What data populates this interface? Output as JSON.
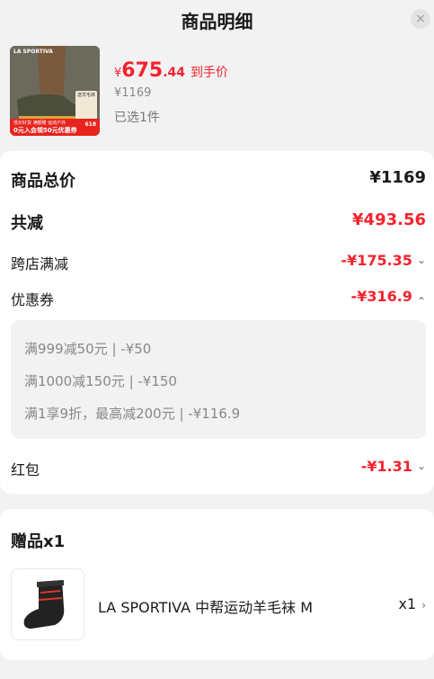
{
  "header": {
    "title": "商品明细",
    "close_label": "×"
  },
  "product": {
    "image_brand": "LA SPORTIVA",
    "image_badge": "送羊毛袜",
    "image_strip_top": "低价好货 满额赠 运动户外",
    "image_strip_main": "0元入会领50元优惠券",
    "image_strip_right": "618",
    "price_currency": "¥",
    "price_int": "675",
    "price_dec": ".44",
    "price_label": "到手价",
    "original_price": "¥1169",
    "selected": "已选1件"
  },
  "summary": {
    "total_label": "商品总价",
    "total_value": "¥1169",
    "discount_label": "共减",
    "discount_value": "¥493.56",
    "cross_store_label": "跨店满减",
    "cross_store_value": "-¥175.35",
    "coupon_label": "优惠券",
    "coupon_value": "-¥316.9",
    "coupon_details": [
      "满999减50元 | -¥50",
      "满1000减150元 | -¥150",
      "满1享9折，最高减200元 | -¥116.9"
    ],
    "redpacket_label": "红包",
    "redpacket_value": "-¥1.31"
  },
  "gifts": {
    "title": "赠品x1",
    "item_name": "LA SPORTIVA 中帮运动羊毛袜 M",
    "item_qty": "x1"
  },
  "colors": {
    "accent_red": "#f5222d",
    "background": "#f2f2f2"
  },
  "icons": [
    "close-icon",
    "chevron-down-icon",
    "chevron-up-icon",
    "chevron-right-icon"
  ]
}
